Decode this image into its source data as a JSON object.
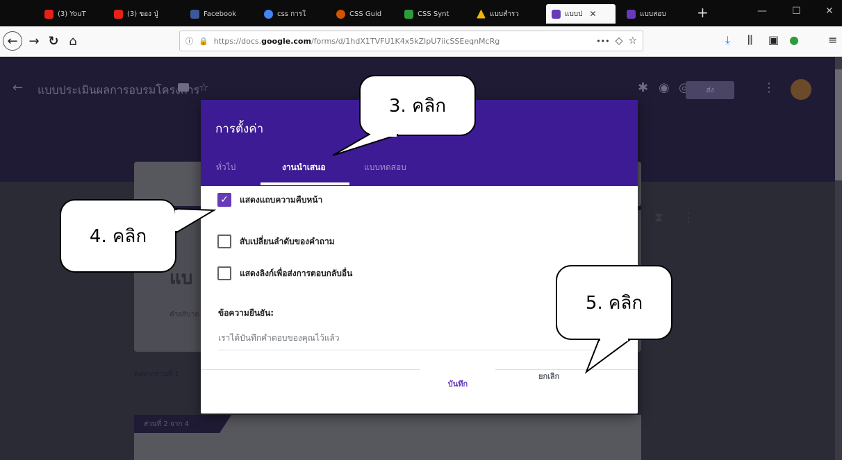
{
  "browser": {
    "tabs": [
      {
        "label": "(3) YouT",
        "fav_color": "#e62117"
      },
      {
        "label": "(3) ของ ปู่",
        "fav_color": "#e62117"
      },
      {
        "label": "Facebook",
        "fav_color": "#3b5998"
      },
      {
        "label": "css การใ",
        "fav_color": "#4285f4"
      },
      {
        "label": "CSS Guid",
        "fav_color": "#d35400"
      },
      {
        "label": "CSS Synt",
        "fav_color": "#2e9c3d"
      },
      {
        "label": "แบบสำรว",
        "fav_color": "#f4b400"
      },
      {
        "label": "แบบป",
        "fav_color": "#673ab7",
        "active": true
      },
      {
        "label": "แบบสอบ",
        "fav_color": "#673ab7"
      }
    ],
    "new_tab": "+",
    "url_prefix": "https://docs.",
    "url_domain": "google.com",
    "url_path": "/forms/d/1hdX1TVFU1K4x5kZlpU7iicSSEeqnMcRg",
    "more_icon": "•••"
  },
  "form": {
    "title": "แบบประเมินผลการอบรมโครงการ",
    "send_label": "ส่ง",
    "section_after": "ต่อจากส่วนที่ 1",
    "section_tag": "ส่วนที่ 2 จาก 4",
    "card_title_partial": "แบ",
    "card_desc_partial": "คำอธิบาย"
  },
  "dialog": {
    "title": "การตั้งค่า",
    "tabs": [
      "ทั่วไป",
      "งานนำเสนอ",
      "แบบทดสอบ"
    ],
    "options": [
      {
        "label": "แสดงแถบความคืบหน้า",
        "checked": true
      },
      {
        "label": "สับเปลี่ยนลำดับของคำถาม",
        "checked": false
      },
      {
        "label": "แสดงลิงก์เพื่อส่งการตอบกลับอื่น",
        "checked": false
      }
    ],
    "confirm_label": "ข้อความยืนยัน:",
    "confirm_value": "เราได้บันทึกคำตอบของคุณไว้แล้ว",
    "cancel_label": "ยกเลิก",
    "save_label": "บันทึก"
  },
  "callouts": {
    "step3": "3. คลิก",
    "step4": "4. คลิก",
    "step5": "5. คลิก"
  }
}
